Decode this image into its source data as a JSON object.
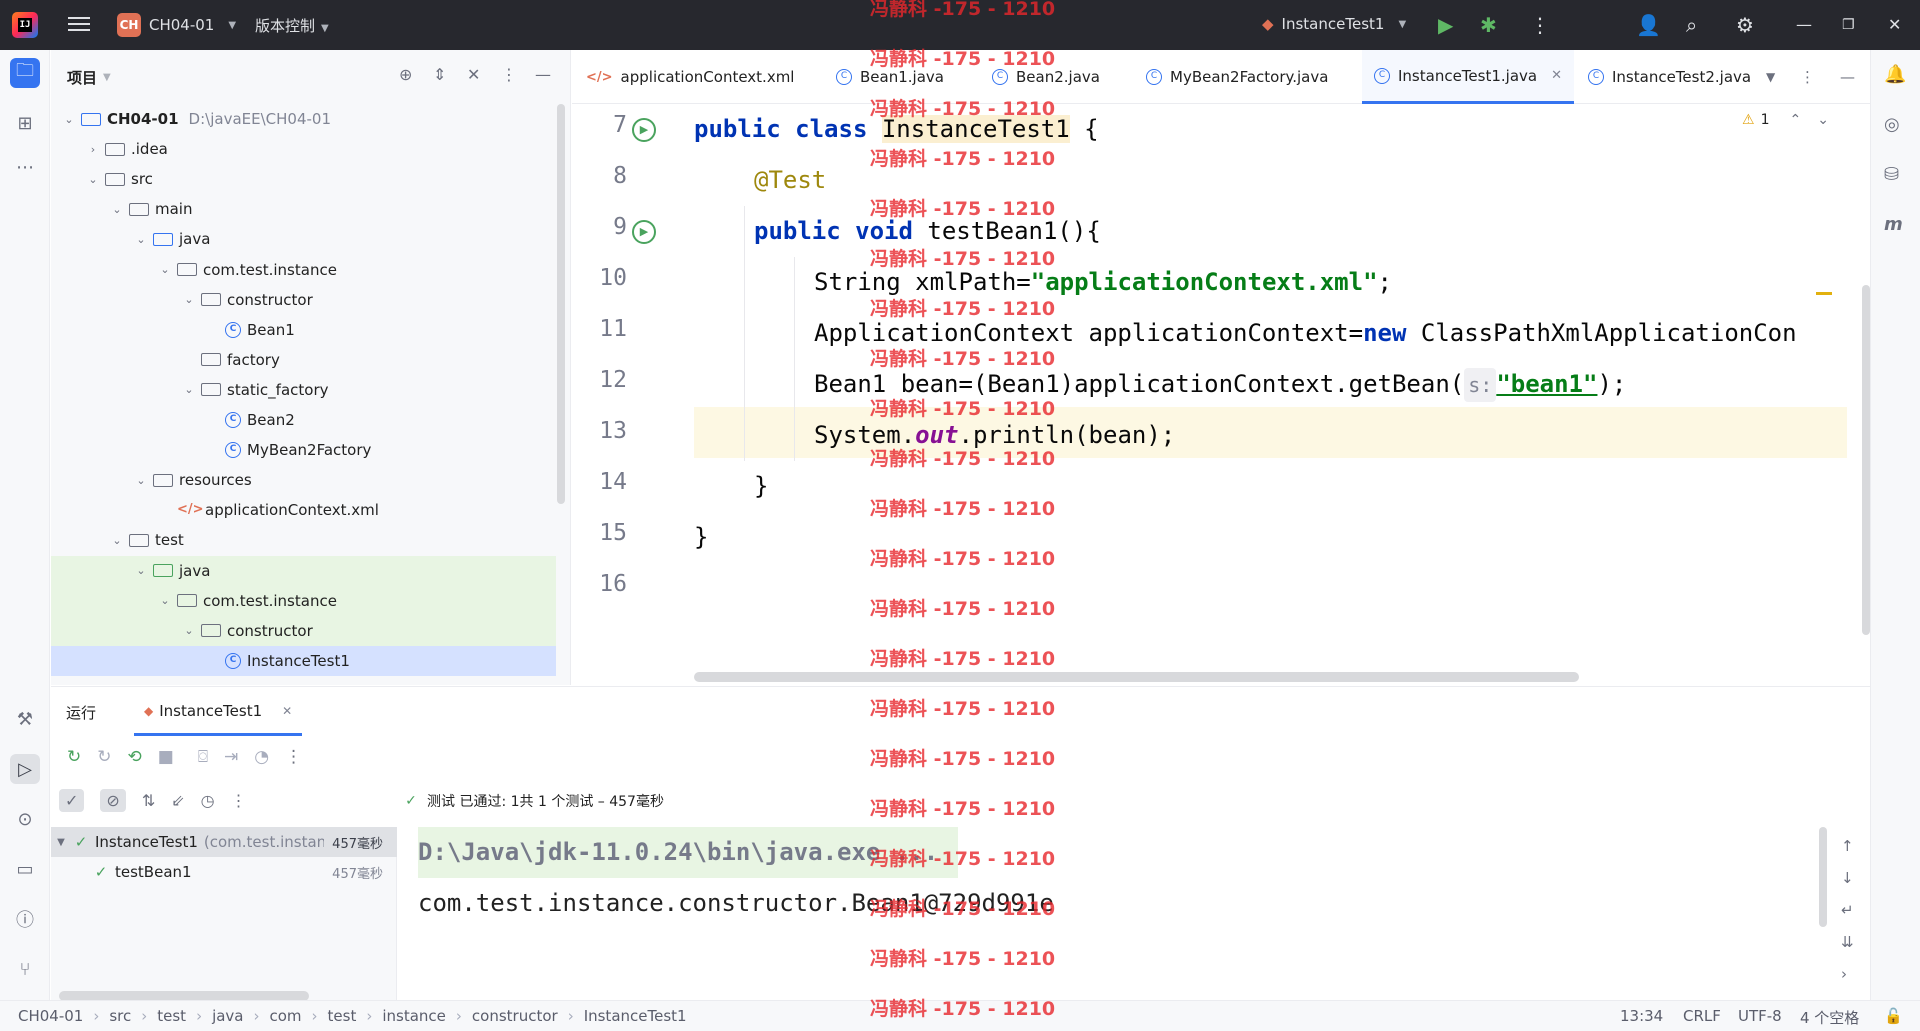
{
  "titlebar": {
    "project_badge": "CH",
    "project_name": "CH04-01",
    "vcs_label": "版本控制",
    "run_config": "InstanceTest1"
  },
  "project_panel": {
    "title": "项目",
    "tree": [
      {
        "label": "CH04-01",
        "extra": "D:\\javaEE\\CH04-01",
        "type": "module"
      },
      {
        "label": ".idea",
        "type": "folder"
      },
      {
        "label": "src",
        "type": "folder"
      },
      {
        "label": "main",
        "type": "folder"
      },
      {
        "label": "java",
        "type": "folder-blue"
      },
      {
        "label": "com.test.instance",
        "type": "package"
      },
      {
        "label": "constructor",
        "type": "package"
      },
      {
        "label": "Bean1",
        "type": "class"
      },
      {
        "label": "factory",
        "type": "package"
      },
      {
        "label": "static_factory",
        "type": "package"
      },
      {
        "label": "Bean2",
        "type": "class"
      },
      {
        "label": "MyBean2Factory",
        "type": "class"
      },
      {
        "label": "resources",
        "type": "folder"
      },
      {
        "label": "applicationContext.xml",
        "type": "xml"
      },
      {
        "label": "test",
        "type": "folder"
      },
      {
        "label": "java",
        "type": "folder-green"
      },
      {
        "label": "com.test.instance",
        "type": "package"
      },
      {
        "label": "constructor",
        "type": "package"
      },
      {
        "label": "InstanceTest1",
        "type": "class"
      }
    ]
  },
  "editor": {
    "tabs": [
      {
        "label": "applicationContext.xml"
      },
      {
        "label": "Bean1.java"
      },
      {
        "label": "Bean2.java"
      },
      {
        "label": "MyBean2Factory.java"
      },
      {
        "label": "InstanceTest1.java"
      },
      {
        "label": "InstanceTest2.java"
      }
    ],
    "warning_count": "1",
    "line_numbers": [
      "7",
      "8",
      "9",
      "10",
      "11",
      "12",
      "13",
      "14",
      "15",
      "16"
    ],
    "code": {
      "l7_kw": "public class ",
      "l7_cls": "InstanceTest1",
      "l7_end": " {",
      "l8": "@Test",
      "l9_kw": "public void ",
      "l9_end": "testBean1(){",
      "l10_a": "String xmlPath=",
      "l10_str": "\"applicationContext.xml\"",
      "l10_end": ";",
      "l11_a": "ApplicationContext applicationContext=",
      "l11_kw": "new",
      "l11_end": " ClassPathXmlApplicationCon",
      "l12_a": "Bean1 bean=(Bean1)applicationContext.getBean(",
      "l12_hint": "s:",
      "l12_str": "\"bean1\"",
      "l12_end": ");",
      "l13_a": "System.",
      "l13_fld": "out",
      "l13_end": ".println(bean);",
      "l14": "}",
      "l15": "}"
    }
  },
  "run_panel": {
    "tab_run": "运行",
    "tab_config": "InstanceTest1",
    "status": "测试 已通过: 1共 1 个测试 – 457毫秒",
    "tree": [
      {
        "label": "InstanceTest1",
        "extra": "(com.test.instan",
        "time": "457毫秒"
      },
      {
        "label": "testBean1",
        "time": "457毫秒"
      }
    ],
    "console": [
      "D:\\Java\\jdk-11.0.24\\bin\\java.exe ...",
      "com.test.instance.constructor.Bean1@729d991e"
    ]
  },
  "statusbar": {
    "breadcrumb": [
      "CH04-01",
      "src",
      "test",
      "java",
      "com",
      "test",
      "instance",
      "constructor",
      "InstanceTest1"
    ],
    "position": "13:34",
    "line_sep": "CRLF",
    "encoding": "UTF-8",
    "indent": "4 个空格"
  },
  "watermark": "冯静科 -175 - 1210"
}
